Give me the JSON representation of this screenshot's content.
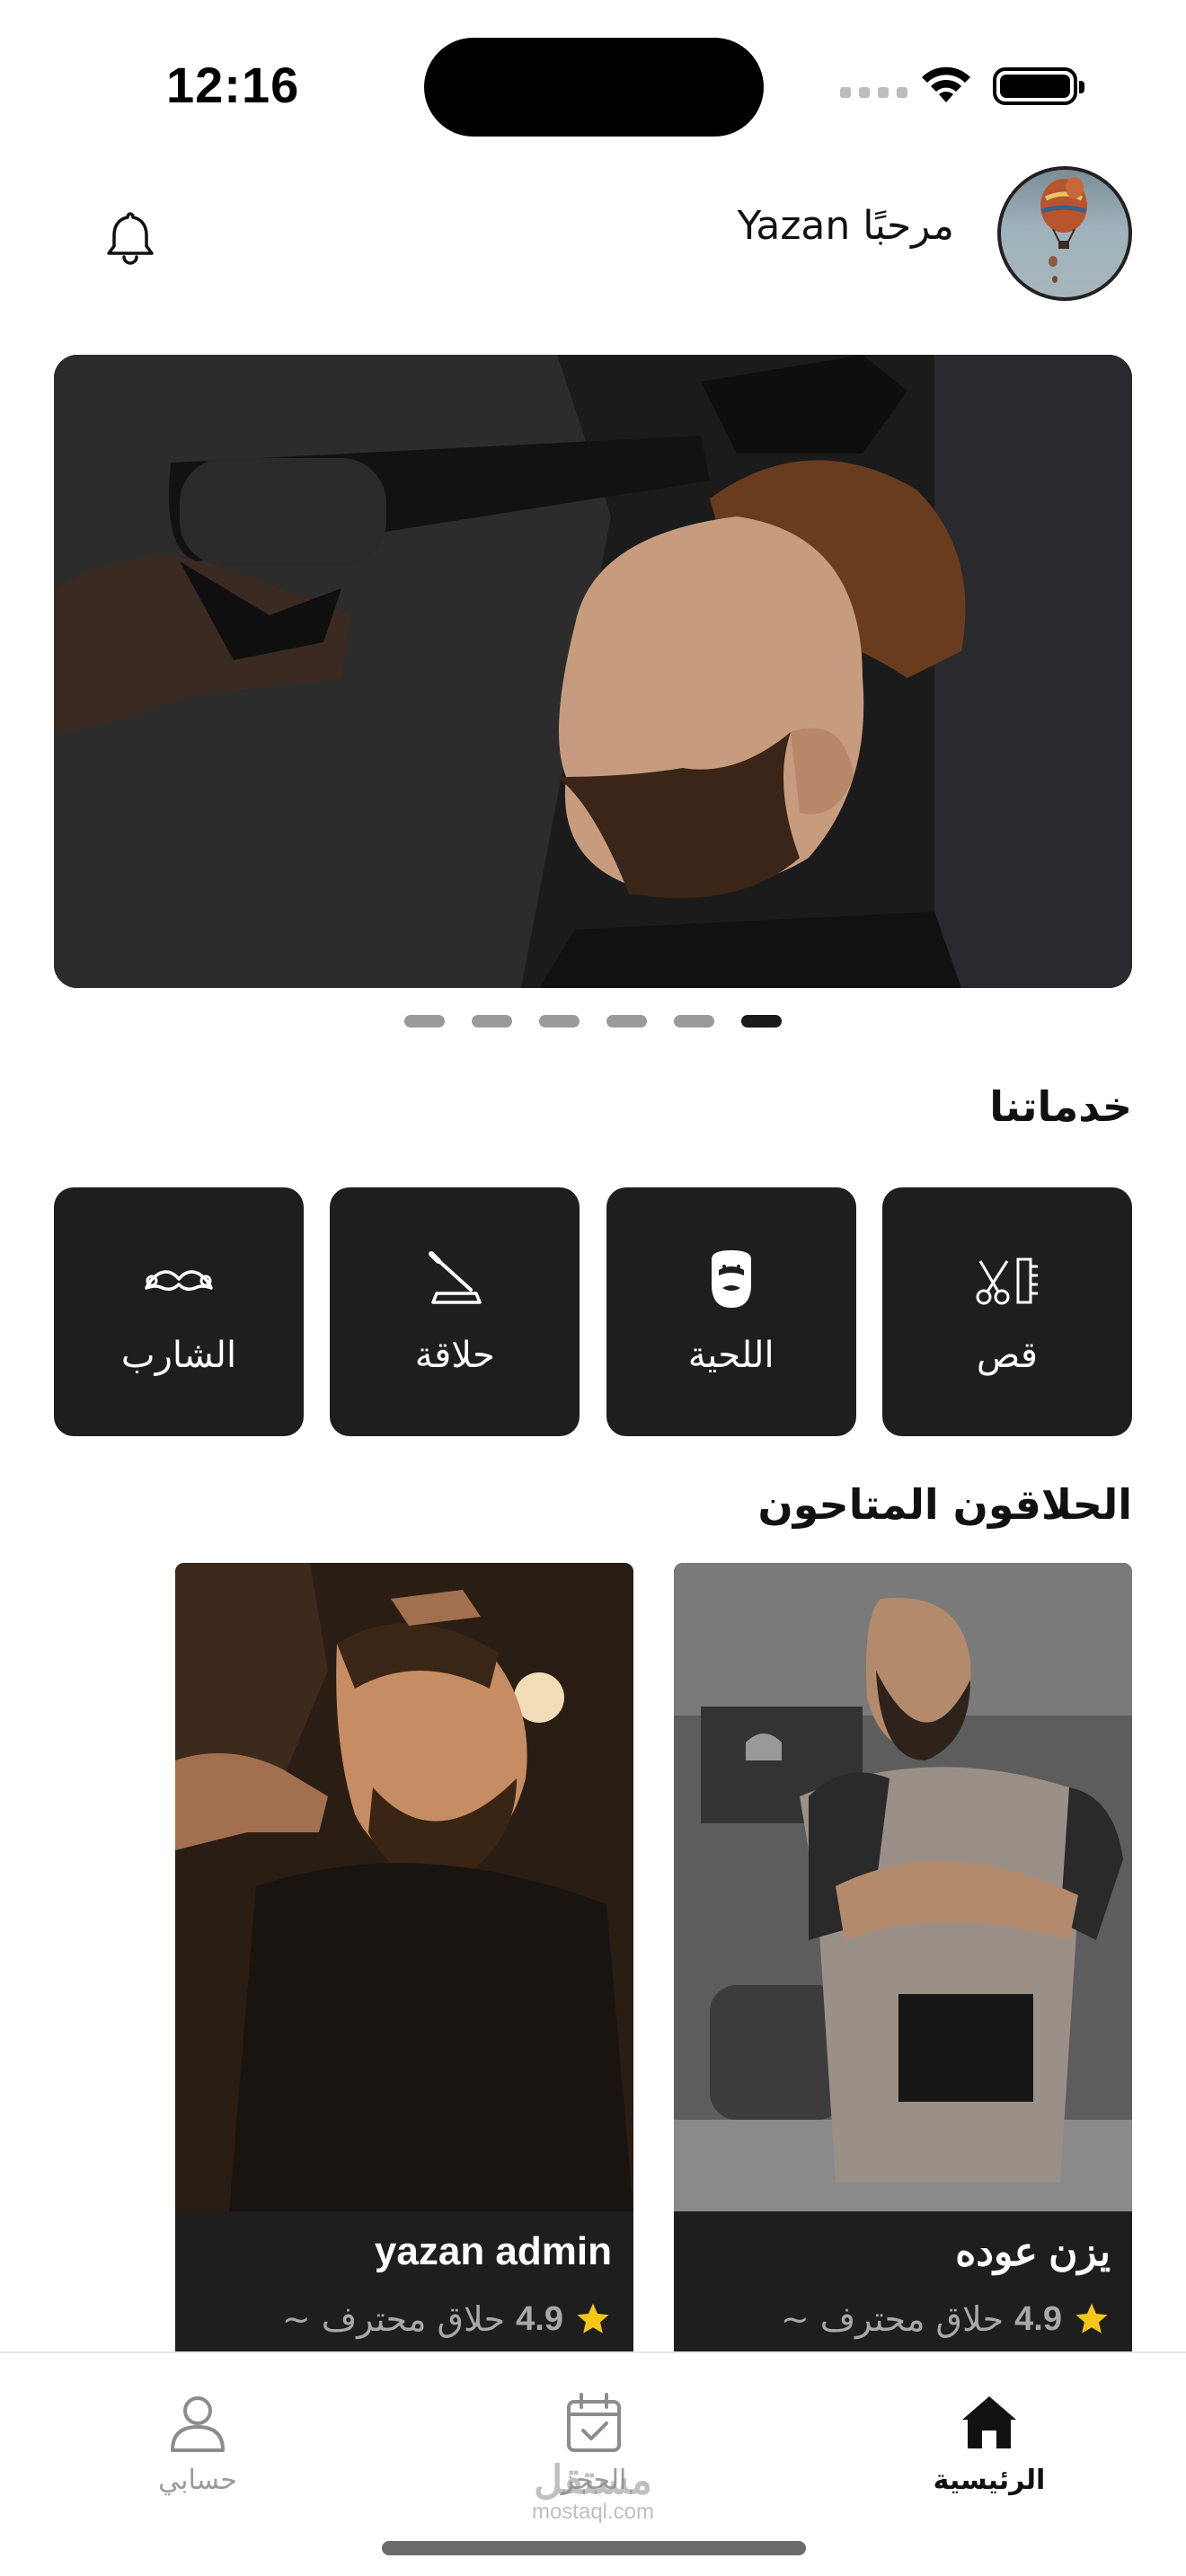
{
  "status_bar": {
    "time": "12:16"
  },
  "header": {
    "greeting": "مرحبًا Yazan",
    "notification_icon": "bell-icon",
    "avatar_icon": "hot-air-balloon-avatar"
  },
  "banner": {
    "slide_count": 6,
    "active_slide": 6
  },
  "services_section": {
    "title": "خدماتنا",
    "items": [
      {
        "label": "قص",
        "icon": "scissors-comb-icon"
      },
      {
        "label": "اللحية",
        "icon": "beard-icon"
      },
      {
        "label": "حلاقة",
        "icon": "razor-icon"
      },
      {
        "label": "الشارب",
        "icon": "mustache-icon"
      }
    ]
  },
  "barbers_section": {
    "title": "الحلاقون المتاحون",
    "barbers": [
      {
        "name": "يزن عوده",
        "rating": "4.9",
        "role": "~ حلاق محترف"
      },
      {
        "name": "yazan admin",
        "rating": "4.9",
        "role": "~ حلاق محترف"
      }
    ]
  },
  "bottom_nav": {
    "items": [
      {
        "label": "الرئيسية",
        "icon": "home-icon",
        "active": true
      },
      {
        "label": "الحجز",
        "icon": "calendar-check-icon",
        "active": false
      },
      {
        "label": "حسابي",
        "icon": "user-icon",
        "active": false
      }
    ]
  },
  "watermark": {
    "arabic": "مستقل",
    "latin": "mostaql.com"
  },
  "colors": {
    "card_bg": "#1e1e1e",
    "star": "#f5c518",
    "active_nav": "#111111",
    "inactive_nav": "#9b9b9b"
  }
}
